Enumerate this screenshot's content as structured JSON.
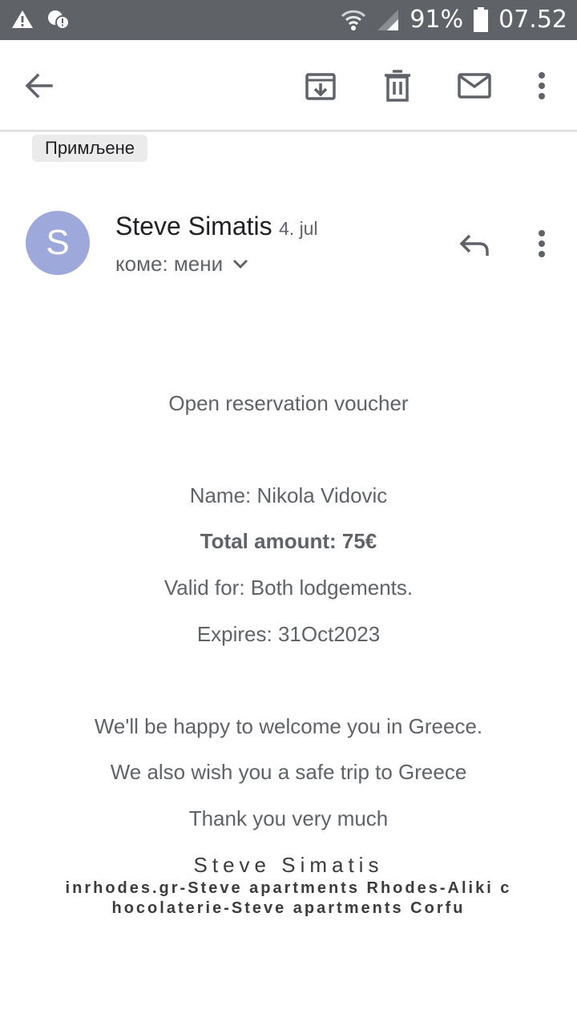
{
  "status_bar": {
    "battery": "91%",
    "time": "07.52",
    "icons": [
      "warning-icon",
      "sync-alert-icon",
      "wifi-icon",
      "signal-icon",
      "battery-icon"
    ]
  },
  "toolbar": {
    "icons": [
      "back-arrow-icon",
      "archive-icon",
      "delete-icon",
      "mail-icon",
      "more-vert-icon"
    ]
  },
  "label_chip": "Примљене",
  "email": {
    "avatar_letter": "S",
    "avatar_color": "#9fa8da",
    "sender": "Steve Simatis",
    "date": "4. jul",
    "recipient": "коме: мени"
  },
  "body": {
    "heading": "Open reservation voucher",
    "name": "Name: Nikola Vidovic",
    "total": "Total amount: 75€",
    "valid": "Valid for:  Both lodgements.",
    "expires": "Expires: 31Oct2023",
    "welcome": "We'll be happy to welcome you in Greece.",
    "safe_trip": "We also wish you a safe trip to Greece",
    "thanks": "Thank you very much"
  },
  "signature": {
    "name": "Steve Simatis",
    "line1": "inrhodes.gr-Steve apartments Rhodes-Aliki c",
    "line2": "hocolaterie-Steve apartments Corfu"
  }
}
